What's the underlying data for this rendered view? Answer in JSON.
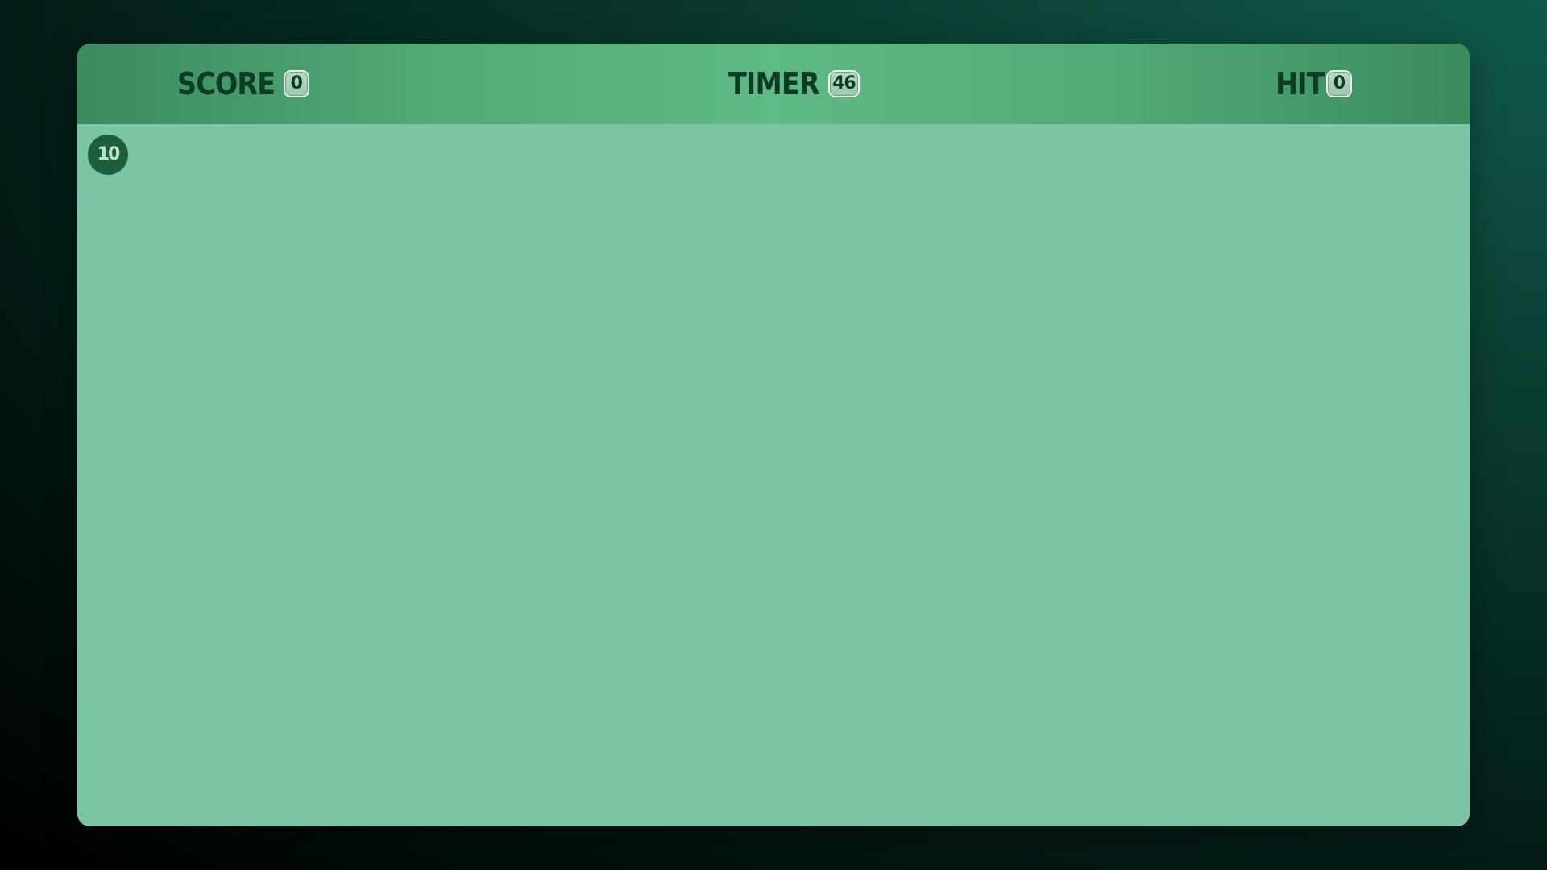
{
  "hud": {
    "score": {
      "label": "SCORE",
      "value": "0"
    },
    "timer": {
      "label": "TIMER",
      "value": "46"
    },
    "hit": {
      "label": "HIT",
      "value": "0"
    }
  },
  "play_area": {
    "targets": [
      {
        "label": "10"
      }
    ]
  },
  "colors": {
    "background_dark": "#000000",
    "background_teal": "#0f5a4a",
    "hud_bar": "#5fbb85",
    "play_area": "#7bc5a5",
    "target": "#1f5e3c",
    "label_text": "#0d3b25"
  }
}
